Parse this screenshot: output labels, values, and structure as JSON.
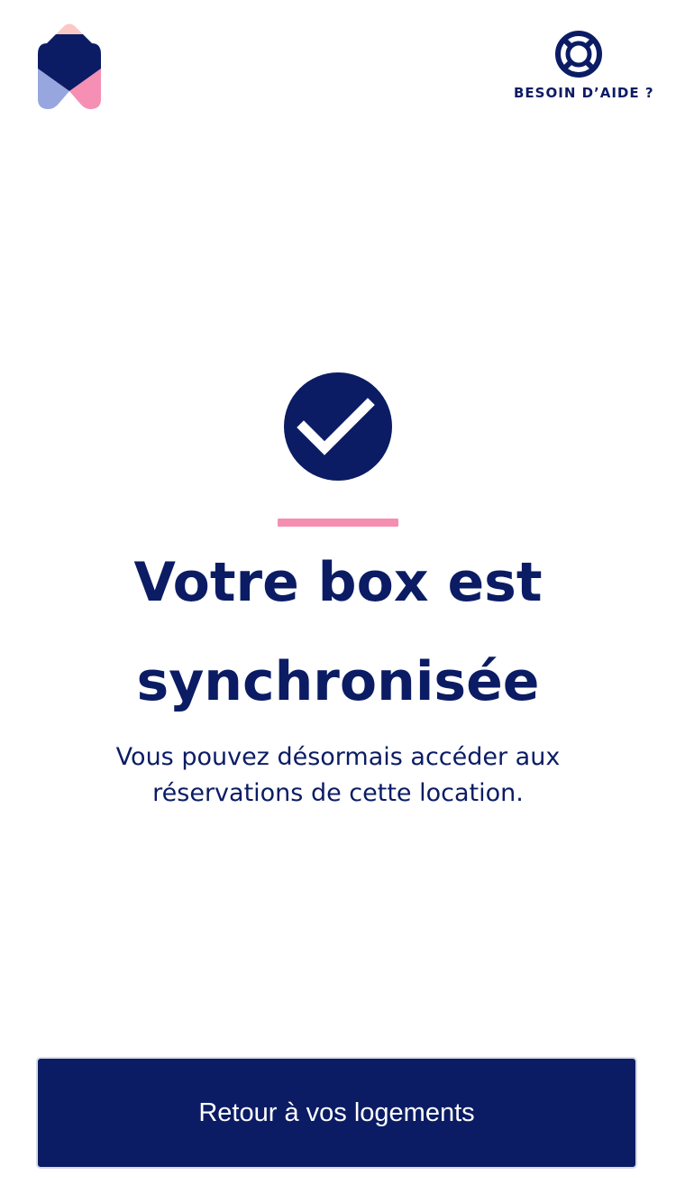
{
  "header": {
    "logo_icon": "brand-house-logo-icon",
    "help": {
      "icon": "lifebuoy-icon",
      "label": "BESOIN D’AIDE ?"
    }
  },
  "main": {
    "status_icon": "check-circle-icon",
    "title_line1": "Votre box est",
    "title_line2": "synchronisée",
    "subtitle_line1": "Vous pouvez désormais accéder aux",
    "subtitle_line2": "réservations de cette location."
  },
  "footer": {
    "cta_label": "Retour à vos logements"
  },
  "colors": {
    "primary": "#0b1c64",
    "accent_pink": "#f48fb1",
    "logo_light_pink": "#fbc8c5",
    "logo_lavender": "#97a6de",
    "logo_pink": "#f58fb4",
    "background": "#ffffff"
  }
}
